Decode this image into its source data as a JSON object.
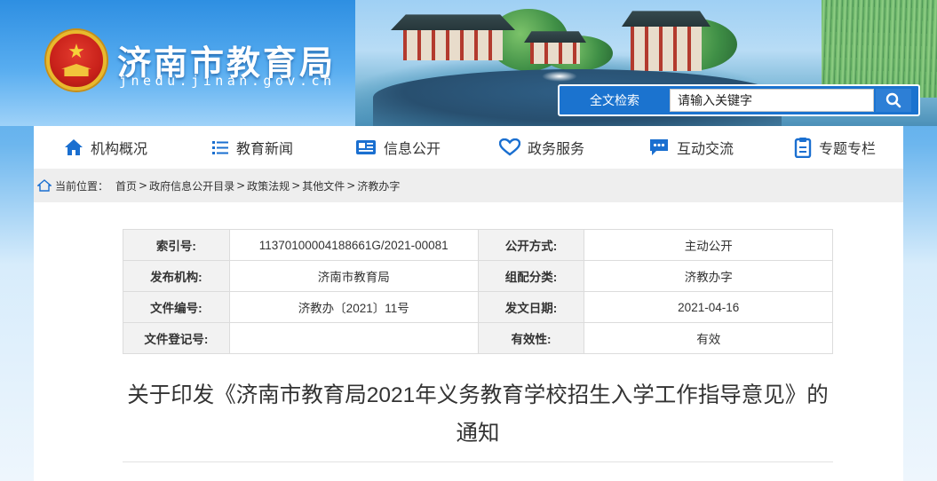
{
  "header": {
    "site_title": "济南市教育局",
    "site_domain": "jnedu.jinan.gov.cn",
    "emblem_icon": "national-emblem-icon",
    "search": {
      "label": "全文检索",
      "placeholder": "请输入关键字",
      "button_icon": "search-icon"
    }
  },
  "nav": {
    "items": [
      {
        "label": "机构概况",
        "icon": "home-icon"
      },
      {
        "label": "教育新闻",
        "icon": "list-icon"
      },
      {
        "label": "信息公开",
        "icon": "newspaper-icon"
      },
      {
        "label": "政务服务",
        "icon": "heart-icon"
      },
      {
        "label": "互动交流",
        "icon": "chat-icon"
      },
      {
        "label": "专题专栏",
        "icon": "clipboard-icon"
      }
    ]
  },
  "breadcrumb": {
    "icon": "home-outline-icon",
    "prefix": "当前位置：",
    "items": [
      "首页",
      "政府信息公开目录",
      "政策法规",
      "其他文件",
      "济教办字"
    ],
    "separator": ">"
  },
  "meta": {
    "rows": [
      {
        "k1": "索引号:",
        "v1": "11370100004188661G/2021-00081",
        "k2": "公开方式:",
        "v2": "主动公开"
      },
      {
        "k1": "发布机构:",
        "v1": "济南市教育局",
        "k2": "组配分类:",
        "v2": "济教办字"
      },
      {
        "k1": "文件编号:",
        "v1": "济教办〔2021〕11号",
        "k2": "发文日期:",
        "v2": "2021-04-16"
      },
      {
        "k1": "文件登记号:",
        "v1": "",
        "k2": "有效性:",
        "v2": "有效"
      }
    ]
  },
  "document": {
    "title": "关于印发《济南市教育局2021年义务教育学校招生入学工作指导意见》的通知"
  },
  "colors": {
    "header_blue": "#2e8fe2",
    "nav_icon_blue": "#1a6fd0",
    "search_blue": "#1b73cf"
  }
}
